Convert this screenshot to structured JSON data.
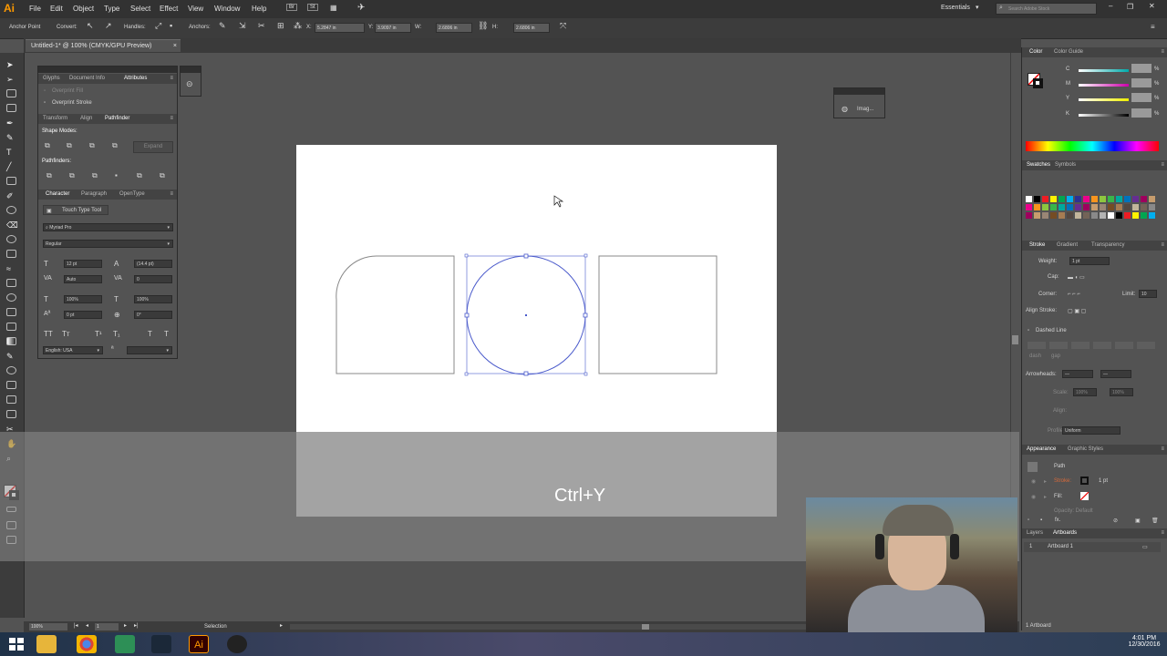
{
  "app": {
    "logo": "Ai",
    "menu": [
      "File",
      "Edit",
      "Object",
      "Type",
      "Select",
      "Effect",
      "View",
      "Window",
      "Help"
    ],
    "bridge_buttons": [
      "Br",
      "St"
    ],
    "workspace": "Essentials",
    "search_placeholder": "Search Adobe Stock"
  },
  "control_bar": {
    "tool_name": "Anchor Point",
    "convert_label": "Convert:",
    "handles_label": "Handles:",
    "anchors_label": "Anchors:",
    "x_value": "5.2847 in",
    "y_value": "3.9097 in",
    "w_label": "W:",
    "w_value": "2.6806 in",
    "h_label": "H:",
    "h_value": "2.6806 in"
  },
  "document_tab": {
    "title": "Untitled-1* @ 100% (CMYK/GPU Preview)",
    "close": "×"
  },
  "left_panels": {
    "attributes": {
      "tabs": [
        "Glyphs",
        "Document Info",
        "Attributes"
      ],
      "overprint_fill": "Overprint Fill",
      "overprint_stroke": "Overprint Stroke"
    },
    "pathfinder": {
      "tabs": [
        "Transform",
        "Align",
        "Pathfinder"
      ],
      "shape_modes": "Shape Modes:",
      "expand": "Expand",
      "pathfinders": "Pathfinders:"
    },
    "character": {
      "tabs": [
        "Character",
        "Paragraph",
        "OpenType"
      ],
      "touch_type": "Touch Type Tool",
      "font_family": "Myriad Pro",
      "font_style": "Regular",
      "size": "12 pt",
      "leading": "(14.4 pt)",
      "kerning": "Auto",
      "tracking": "0",
      "h_scale": "100%",
      "v_scale": "100%",
      "baseline": "0 pt",
      "rotation": "0°",
      "language": "English: USA"
    },
    "image_panel": "Imag..."
  },
  "right_panels": {
    "color": {
      "tabs": [
        "Color",
        "Color Guide"
      ],
      "channels": [
        "C",
        "M",
        "Y",
        "K"
      ],
      "percent": "%"
    },
    "swatches": {
      "tabs": [
        "Swatches",
        "Symbols"
      ]
    },
    "stroke": {
      "tabs": [
        "Stroke",
        "Gradient",
        "Transparency"
      ],
      "weight_label": "Weight:",
      "weight_value": "1 pt",
      "cap_label": "Cap:",
      "corner_label": "Corner:",
      "limit_label": "Limit:",
      "limit_value": "10",
      "align_label": "Align Stroke:",
      "dashed_line": "Dashed Line",
      "dash": "dash",
      "gap": "gap",
      "arrowheads_label": "Arrowheads:",
      "scale_label": "Scale:",
      "scale_value": "100%",
      "align2_label": "Align:",
      "profile_label": "Profile:",
      "profile_value": "Uniform"
    },
    "appearance": {
      "tabs": [
        "Appearance",
        "Graphic Styles"
      ],
      "path": "Path",
      "stroke_label": "Stroke:",
      "stroke_value": "1 pt",
      "fill_label": "Fill:",
      "opacity": "Opacity: Default",
      "fx": "fx."
    },
    "layers": {
      "tabs": [
        "Layers",
        "Artboards"
      ],
      "row_index": "1",
      "row_name": "Artboard 1",
      "footer": "1 Artboard"
    }
  },
  "canvas": {
    "shortcut_overlay": "Ctrl+Y"
  },
  "status": {
    "zoom": "100%",
    "artboard_nav": "1",
    "mode": "Selection"
  },
  "taskbar": {
    "time": "4:01 PM",
    "date": "12/30/2016"
  },
  "colors": {
    "accent": "#4a5acb",
    "artboard": "#ffffff",
    "panel_bg": "#535353",
    "illustrator_orange": "#ff9a00"
  }
}
